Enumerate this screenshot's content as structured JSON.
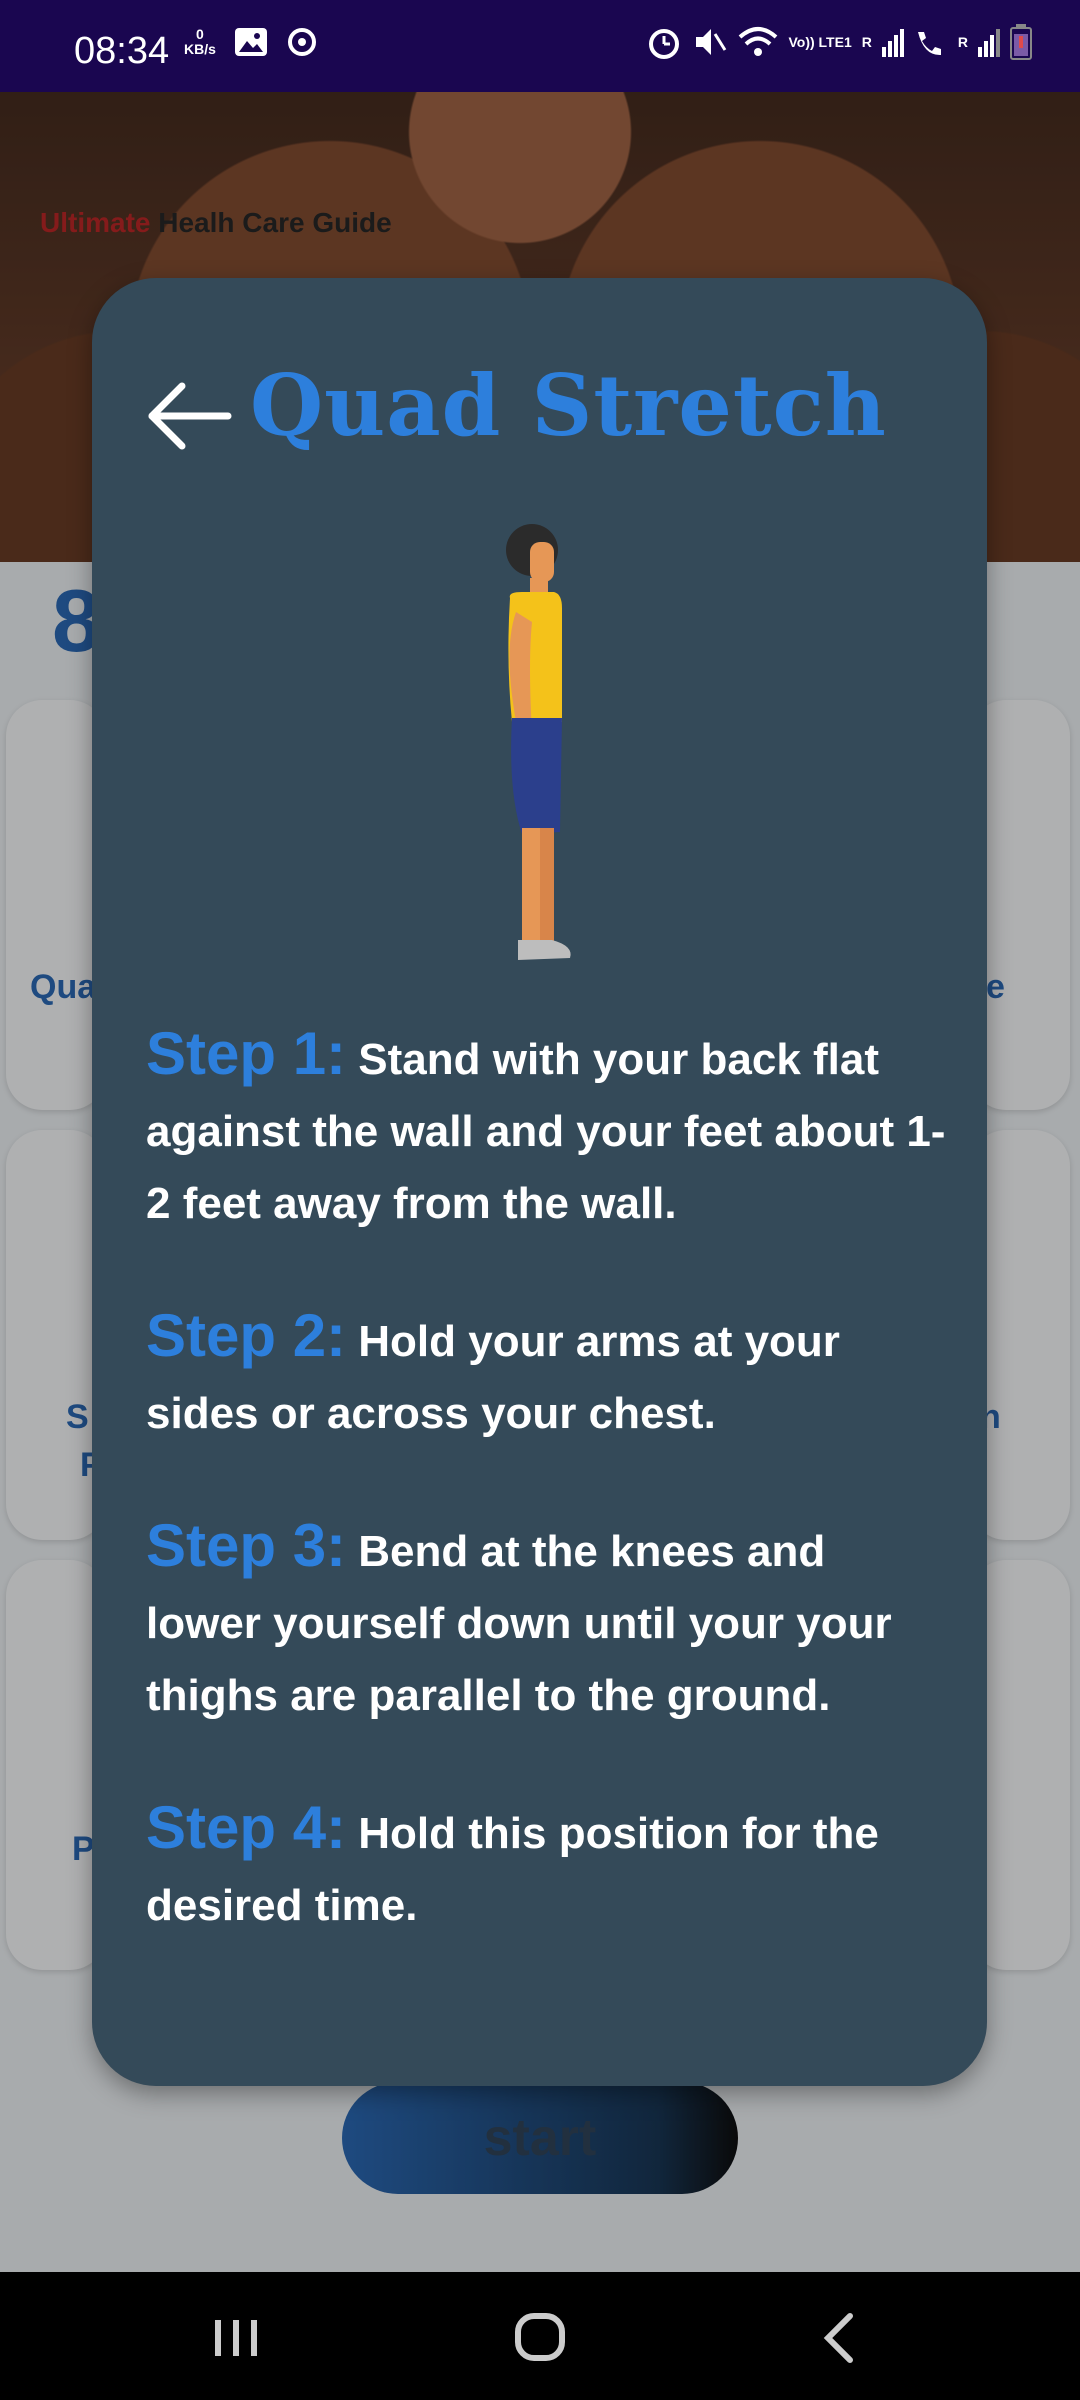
{
  "status_bar": {
    "time": "08:34",
    "speed_value": "0",
    "speed_unit": "KB/s",
    "volte_tag": "Vo)) LTE1",
    "sim1_tag": "R",
    "sim2_tag": "R",
    "battery_color": "#e04a4a"
  },
  "hero": {
    "title_part1": "Ultimate",
    "title_part2": " Healh Care Guide"
  },
  "background": {
    "page_number": "8",
    "card_labels": [
      "Qua",
      "e",
      "S",
      "P",
      "n",
      "P"
    ],
    "start_label": "start"
  },
  "modal": {
    "title": "Quad Stretch",
    "steps": [
      {
        "label": "Step 1:",
        "text": " Stand with your back flat against the wall and your feet about 1-2 feet away from the wall."
      },
      {
        "label": "Step 2:",
        "text": " Hold your arms at your sides or across your chest."
      },
      {
        "label": "Step 3:",
        "text": " Bend at the knees and lower yourself down until your your thighs are parallel to the ground."
      },
      {
        "label": "Step 4:",
        "text": " Hold this position for the desired time."
      }
    ]
  },
  "colors": {
    "modal_bg": "#344a59",
    "accent": "#2d7fdc",
    "status_bar": "#1a0650"
  },
  "icons": [
    "alarm-icon",
    "mute-icon",
    "wifi-icon",
    "signal-icon",
    "battery-icon",
    "back-arrow-icon",
    "recents-icon",
    "home-icon",
    "back-icon"
  ]
}
